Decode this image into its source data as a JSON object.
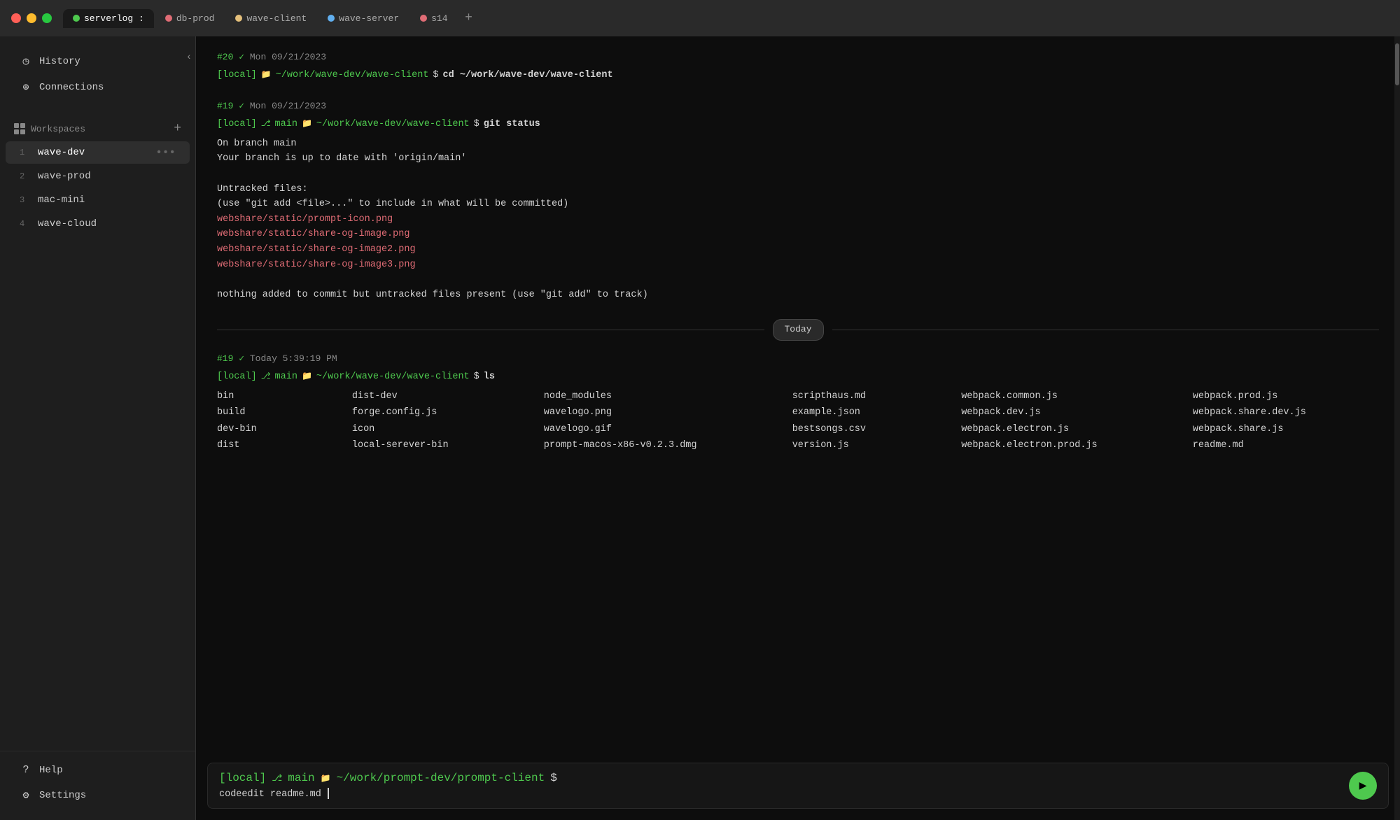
{
  "titlebar": {
    "tabs": [
      {
        "id": "serverlog",
        "label": "serverlog :",
        "color": "#4ec94e",
        "active": true
      },
      {
        "id": "db-prod",
        "label": "db-prod",
        "color": "#e06c75",
        "active": false
      },
      {
        "id": "wave-client",
        "label": "wave-client",
        "color": "#e5c07b",
        "active": false
      },
      {
        "id": "wave-server",
        "label": "wave-server",
        "color": "#61afef",
        "active": false
      },
      {
        "id": "s14",
        "label": "s14",
        "color": "#e06c75",
        "active": false
      }
    ],
    "plus_label": "+"
  },
  "sidebar": {
    "collapse_icon": "‹",
    "nav_items": [
      {
        "id": "history",
        "label": "History",
        "icon": "◷"
      },
      {
        "id": "connections",
        "label": "Connections",
        "icon": "⊕"
      }
    ],
    "workspaces_section": {
      "title": "Workspaces",
      "add_icon": "+",
      "items": [
        {
          "num": "1",
          "name": "wave-dev",
          "active": true
        },
        {
          "num": "2",
          "name": "wave-prod",
          "active": false
        },
        {
          "num": "3",
          "name": "mac-mini",
          "active": false
        },
        {
          "num": "4",
          "name": "wave-cloud",
          "active": false
        }
      ]
    },
    "bottom_items": [
      {
        "id": "help",
        "label": "Help",
        "icon": "?"
      },
      {
        "id": "settings",
        "label": "Settings",
        "icon": "⚙"
      }
    ]
  },
  "terminal": {
    "blocks": [
      {
        "id": "block1",
        "cmd_num": "#20",
        "check": "✓",
        "date": "Mon 09/21/2023",
        "prompt_local": "[local]",
        "prompt_path": "~/work/wave-dev/wave-client",
        "dollar": "$",
        "command": "cd ~/work/wave-dev/wave-client",
        "output": []
      },
      {
        "id": "block2",
        "cmd_num": "#19",
        "check": "✓",
        "date": "Mon 09/21/2023",
        "prompt_local": "[local]",
        "prompt_branch": "main",
        "prompt_path": "~/work/wave-dev/wave-client",
        "dollar": "$",
        "command": "git status",
        "output_text": "On branch main\nYour branch is up to date with 'origin/main'\n\nUntracked files:\n  (use \"git add <file>...\" to include in what will be committed)",
        "red_files": [
          "webshare/static/prompt-icon.png",
          "webshare/static/share-og-image.png",
          "webshare/static/share-og-image2.png",
          "webshare/static/share-og-image3.png"
        ],
        "footer_text": "nothing added to commit but untracked files present (use \"git add\" to track)"
      }
    ],
    "today_divider": "Today",
    "today_block": {
      "cmd_num": "#19",
      "check": "✓",
      "date": "Today 5:39:19 PM",
      "prompt_local": "[local]",
      "prompt_branch": "main",
      "prompt_path": "~/work/wave-dev/wave-client",
      "dollar": "$",
      "command": "ls",
      "ls_files": [
        "bin",
        "dist-dev",
        "node_modules",
        "scripthaus.md",
        "webpack.common.js",
        "webpack.prod.js",
        "build",
        "forge.config.js",
        "wavelogo.png",
        "example.json",
        "webpack.dev.js",
        "webpack.share.dev.js",
        "dev-bin",
        "icon",
        "wavelogo.gif",
        "bestsongs.csv",
        "webpack.electron.js",
        "webpack.share.js",
        "dist",
        "local-serever-bin",
        "prompt-macos-x86-v0.2.3.dmg",
        "version.js",
        "webpack.electron.prod.js",
        "readme.md"
      ]
    },
    "input_bar": {
      "prompt_local": "[local]",
      "prompt_branch": "main",
      "prompt_path": "~/work/prompt-dev/prompt-client",
      "dollar": "$",
      "command_text": "codeedit readme.md",
      "send_label": "▶"
    }
  }
}
